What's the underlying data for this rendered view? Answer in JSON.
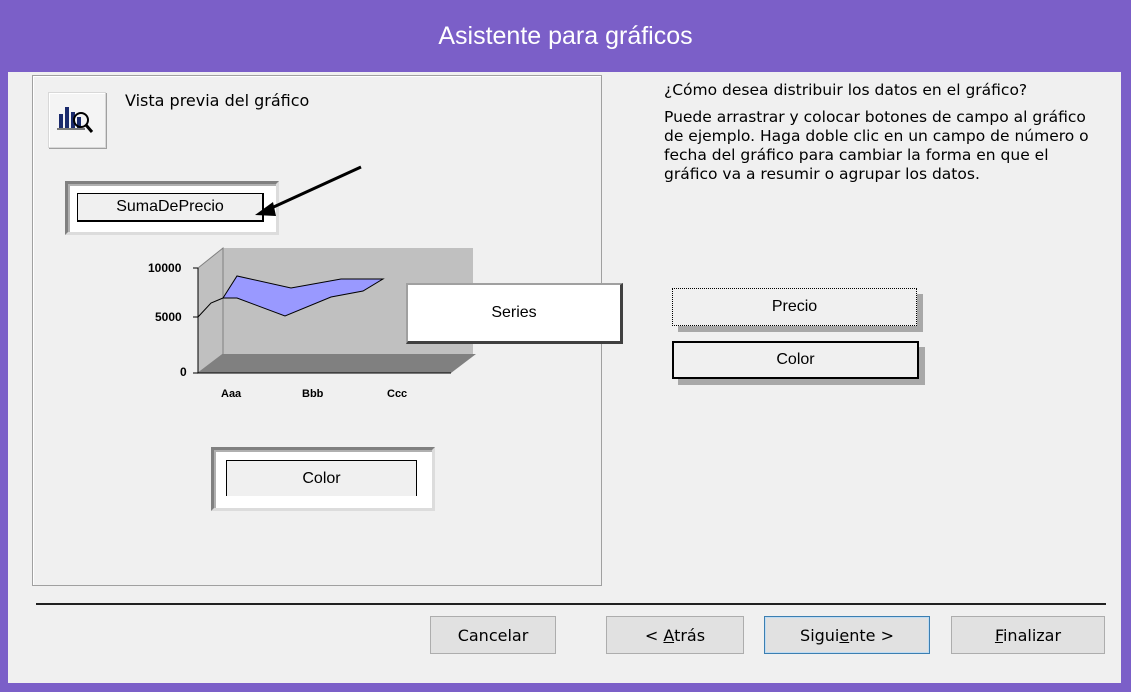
{
  "window": {
    "title": "Asistente para gráficos"
  },
  "preview": {
    "label": "Vista previa del gráfico",
    "icon": "chart-zoom-icon",
    "data_field": "SumaDePrecio",
    "series_field": "Series",
    "axis_field": "Color",
    "chart": {
      "y_ticks": [
        "10000",
        "5000",
        "0"
      ],
      "categories": [
        "Aaa",
        "Bbb",
        "Ccc"
      ]
    }
  },
  "instructions": {
    "question": "¿Cómo desea distribuir los datos en el gráfico?",
    "body": "Puede arrastrar y colocar botones de campo al gráfico de ejemplo. Haga doble clic en un campo de número o fecha del gráfico para cambiar la forma en que el gráfico va a resumir o agrupar los datos."
  },
  "fields": [
    {
      "label": "Precio"
    },
    {
      "label": "Color"
    }
  ],
  "buttons": {
    "cancel": "Cancelar",
    "back_prefix": "< ",
    "back_key": "A",
    "back_rest": "trás",
    "next_prefix": "Sigui",
    "next_key": "e",
    "next_rest": "nte >",
    "finish_key": "F",
    "finish_rest": "inalizar"
  },
  "colors": {
    "title_bar": "#7b5fc8",
    "dialog_bg": "#f0f0f0",
    "series_fill": "#9999ff",
    "chart_wall": "#c0c0c0",
    "chart_floor": "#808080"
  }
}
